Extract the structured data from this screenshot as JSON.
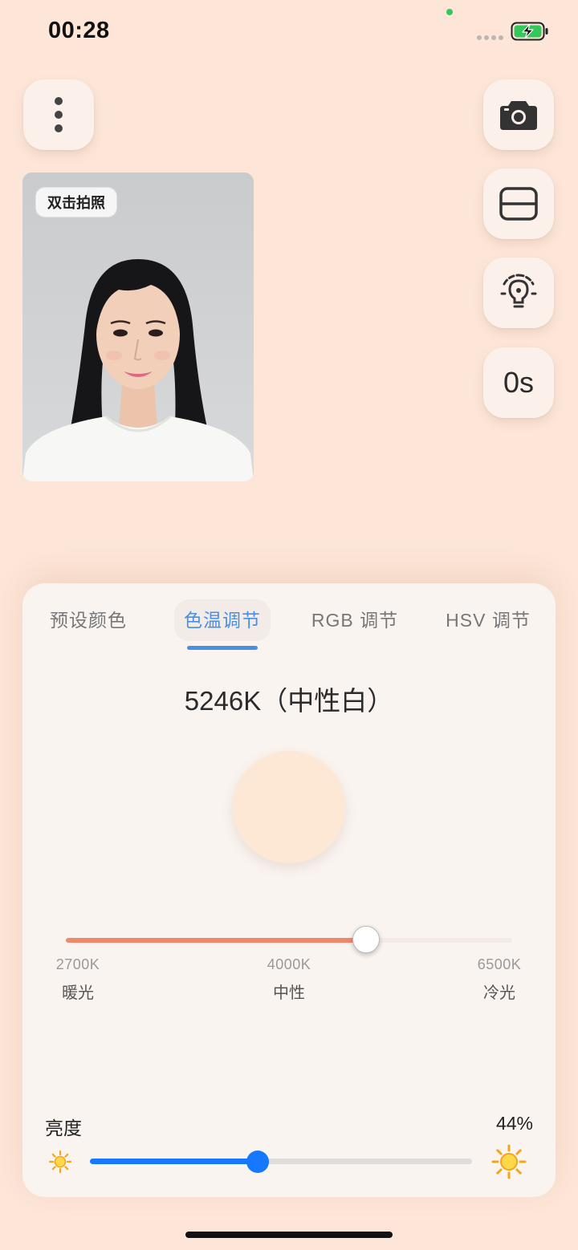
{
  "status_bar": {
    "time": "00:28"
  },
  "top_controls": {
    "timer_label": "0s"
  },
  "preview": {
    "tag": "双击拍照"
  },
  "panel": {
    "tabs": [
      {
        "label": "预设颜色"
      },
      {
        "label": "色温调节"
      },
      {
        "label": "RGB 调节"
      },
      {
        "label": "HSV 调节"
      }
    ],
    "active_tab": 1,
    "temperature": {
      "title": "5246K（中性白）",
      "value_k": 5246,
      "min_k": 2700,
      "max_k": 6500,
      "swatch_color": "#fde8d6",
      "scale": [
        {
          "k": "2700K",
          "name": "暖光"
        },
        {
          "k": "4000K",
          "name": "中性"
        },
        {
          "k": "6500K",
          "name": "冷光"
        }
      ]
    },
    "brightness": {
      "label": "亮度",
      "value_text": "44%",
      "value": 0.44
    }
  },
  "colors": {
    "accent": "#4a90e2",
    "slider_blue": "#1677ff",
    "temp_fill": "#f0896a",
    "background": "#fde6d8"
  }
}
